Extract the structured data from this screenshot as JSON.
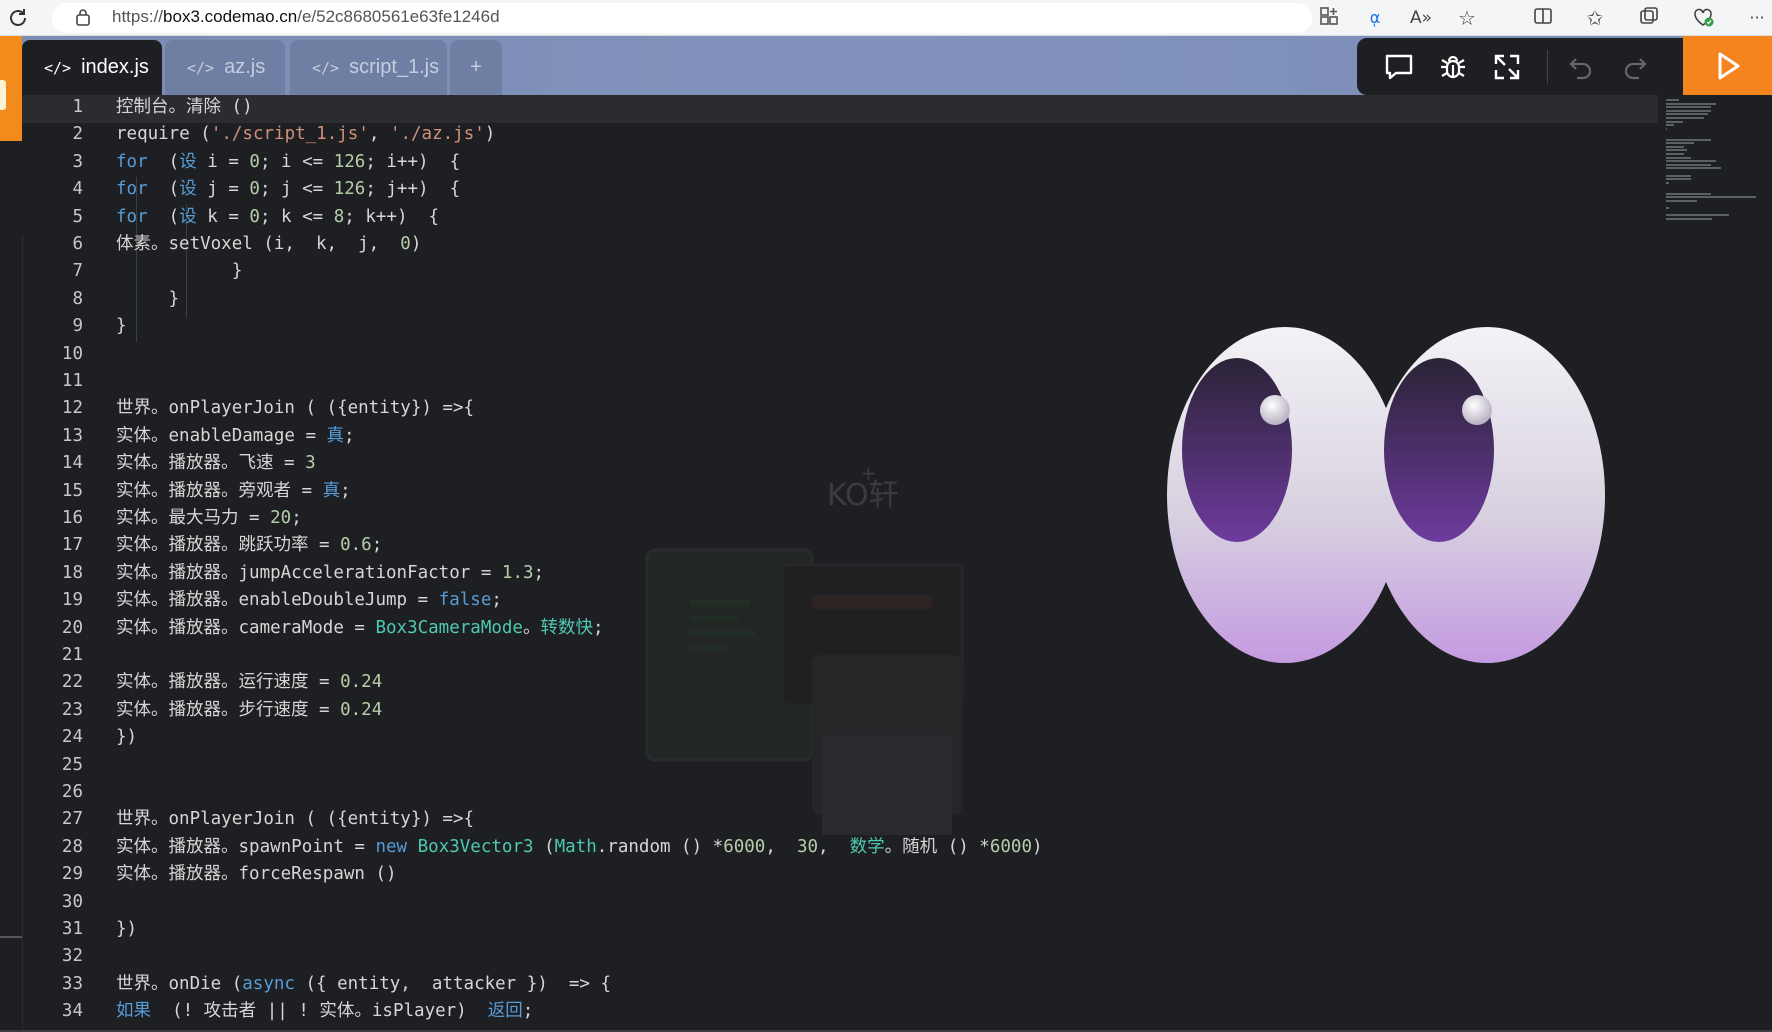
{
  "browser": {
    "url_scheme": "https://",
    "url_host": "box3.codemao.cn",
    "url_path": "/e/52c8680561e63fe1246d",
    "icons": [
      "reload-icon",
      "lock-icon",
      "apps-icon",
      "translate-icon",
      "read-aloud-icon",
      "favorite-star-icon",
      "split-screen-icon",
      "favorites-icon",
      "collections-icon",
      "browser-health-icon",
      "more-icon"
    ]
  },
  "tabs": [
    {
      "label": "index.js",
      "active": true
    },
    {
      "label": "az.js",
      "active": false
    },
    {
      "label": "script_1.js",
      "active": false
    }
  ],
  "add_tab_label": "+",
  "toolbar": {
    "icons": [
      "chat-icon",
      "debug-bug-icon",
      "expand-icon",
      "undo-icon",
      "redo-icon",
      "run-play-icon"
    ]
  },
  "watermark_text": "KO轩",
  "code_lines": [
    {
      "n": "1",
      "segs": [
        [
          "t",
          "控制台。清除 ()"
        ]
      ]
    },
    {
      "n": "2",
      "segs": [
        [
          "t",
          "require ("
        ],
        [
          "s",
          "'./script_1.js'"
        ],
        [
          "t",
          ", "
        ],
        [
          "s",
          "'./az.js'"
        ],
        [
          "t",
          ")"
        ]
      ]
    },
    {
      "n": "3",
      "segs": [
        [
          "k",
          "for"
        ],
        [
          "t",
          "  ("
        ],
        [
          "k",
          "设"
        ],
        [
          "t",
          " i = "
        ],
        [
          "n",
          "0"
        ],
        [
          "t",
          "; i <= "
        ],
        [
          "n",
          "126"
        ],
        [
          "t",
          "; i++)  {"
        ]
      ]
    },
    {
      "n": "4",
      "segs": [
        [
          "k",
          "for"
        ],
        [
          "t",
          "  ("
        ],
        [
          "k",
          "设"
        ],
        [
          "t",
          " j = "
        ],
        [
          "n",
          "0"
        ],
        [
          "t",
          "; j <= "
        ],
        [
          "n",
          "126"
        ],
        [
          "t",
          "; j++)  {"
        ]
      ]
    },
    {
      "n": "5",
      "segs": [
        [
          "k",
          "for"
        ],
        [
          "t",
          "  ("
        ],
        [
          "k",
          "设"
        ],
        [
          "t",
          " k = "
        ],
        [
          "n",
          "0"
        ],
        [
          "t",
          "; k <= "
        ],
        [
          "n",
          "8"
        ],
        [
          "t",
          "; k++)  {"
        ]
      ]
    },
    {
      "n": "6",
      "segs": [
        [
          "t",
          "体素。setVoxel (i,  k,  j,  "
        ],
        [
          "n",
          "0"
        ],
        [
          "t",
          ")"
        ]
      ]
    },
    {
      "n": "7",
      "segs": [
        [
          "t",
          "           }"
        ]
      ]
    },
    {
      "n": "8",
      "segs": [
        [
          "t",
          "     }"
        ]
      ]
    },
    {
      "n": "9",
      "segs": [
        [
          "t",
          "}"
        ]
      ]
    },
    {
      "n": "10",
      "segs": []
    },
    {
      "n": "11",
      "segs": []
    },
    {
      "n": "12",
      "segs": [
        [
          "t",
          "世界。onPlayerJoin ( ({entity}) =>{"
        ]
      ]
    },
    {
      "n": "13",
      "segs": [
        [
          "t",
          "实体。enableDamage = "
        ],
        [
          "k",
          "真"
        ],
        [
          "t",
          ";"
        ]
      ]
    },
    {
      "n": "14",
      "segs": [
        [
          "t",
          "实体。播放器。飞速 = "
        ],
        [
          "n",
          "3"
        ]
      ]
    },
    {
      "n": "15",
      "segs": [
        [
          "t",
          "实体。播放器。旁观者 = "
        ],
        [
          "k",
          "真"
        ],
        [
          "t",
          ";"
        ]
      ]
    },
    {
      "n": "16",
      "segs": [
        [
          "t",
          "实体。最大马力 = "
        ],
        [
          "n",
          "20"
        ],
        [
          "t",
          ";"
        ]
      ]
    },
    {
      "n": "17",
      "segs": [
        [
          "t",
          "实体。播放器。跳跃功率 = "
        ],
        [
          "n",
          "0.6"
        ],
        [
          "t",
          ";"
        ]
      ]
    },
    {
      "n": "18",
      "segs": [
        [
          "t",
          "实体。播放器。jumpAccelerationFactor = "
        ],
        [
          "n",
          "1.3"
        ],
        [
          "t",
          ";"
        ]
      ]
    },
    {
      "n": "19",
      "segs": [
        [
          "t",
          "实体。播放器。enableDoubleJump = "
        ],
        [
          "k",
          "false"
        ],
        [
          "t",
          ";"
        ]
      ]
    },
    {
      "n": "20",
      "segs": [
        [
          "t",
          "实体。播放器。cameraMode = "
        ],
        [
          "c",
          "Box3CameraMode"
        ],
        [
          "t",
          "。"
        ],
        [
          "c",
          "转数快"
        ],
        [
          "t",
          ";"
        ]
      ]
    },
    {
      "n": "21",
      "segs": []
    },
    {
      "n": "22",
      "segs": [
        [
          "t",
          "实体。播放器。运行速度 = "
        ],
        [
          "n",
          "0.24"
        ]
      ]
    },
    {
      "n": "23",
      "segs": [
        [
          "t",
          "实体。播放器。步行速度 = "
        ],
        [
          "n",
          "0.24"
        ]
      ]
    },
    {
      "n": "24",
      "segs": [
        [
          "t",
          "})"
        ]
      ]
    },
    {
      "n": "25",
      "segs": []
    },
    {
      "n": "26",
      "segs": []
    },
    {
      "n": "27",
      "segs": [
        [
          "t",
          "世界。onPlayerJoin ( ({entity}) =>{"
        ]
      ]
    },
    {
      "n": "28",
      "segs": [
        [
          "t",
          "实体。播放器。spawnPoint = "
        ],
        [
          "k",
          "new"
        ],
        [
          "t",
          " "
        ],
        [
          "c",
          "Box3Vector3"
        ],
        [
          "t",
          " ("
        ],
        [
          "c",
          "Math"
        ],
        [
          "t",
          ".random () *"
        ],
        [
          "n",
          "6000"
        ],
        [
          "t",
          ",  "
        ],
        [
          "n",
          "30"
        ],
        [
          "t",
          ",  "
        ],
        [
          "c",
          "数学"
        ],
        [
          "t",
          "。随机 () *"
        ],
        [
          "n",
          "6000"
        ],
        [
          "t",
          ")"
        ]
      ]
    },
    {
      "n": "29",
      "segs": [
        [
          "t",
          "实体。播放器。forceRespawn ()"
        ]
      ]
    },
    {
      "n": "30",
      "segs": []
    },
    {
      "n": "31",
      "segs": [
        [
          "t",
          "})"
        ]
      ]
    },
    {
      "n": "32",
      "segs": []
    },
    {
      "n": "33",
      "segs": [
        [
          "t",
          "世界。onDie ("
        ],
        [
          "k",
          "async"
        ],
        [
          "t",
          " ({ entity,  attacker })  => {"
        ]
      ]
    },
    {
      "n": "34",
      "segs": [
        [
          "k",
          "如果"
        ],
        [
          "t",
          "  (! 攻击者 || ! 实体。isPlayer)  "
        ],
        [
          "k",
          "返回"
        ],
        [
          "t",
          ";"
        ]
      ]
    }
  ],
  "colors": {
    "editor_bg": "#1e1f22",
    "keyword": "#569cd6",
    "number": "#b5cea8",
    "string": "#ce9178",
    "class": "#4ec9b0",
    "accent_orange": "#f5841f",
    "tabbar": "#7b8bb3"
  }
}
